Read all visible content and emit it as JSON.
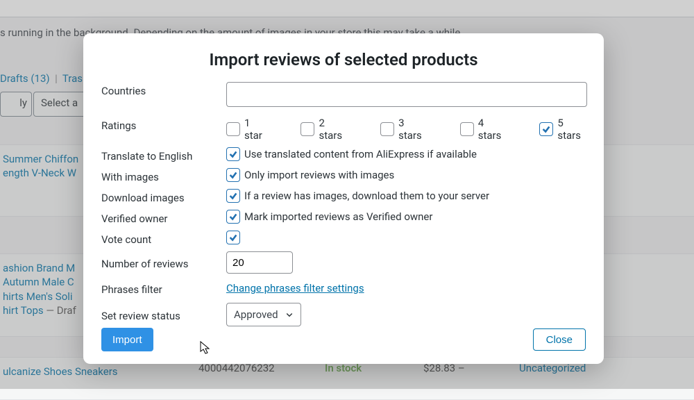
{
  "background": {
    "notice": "s running in the background. Depending on the amount of images in your store this may take a while.",
    "filters": {
      "drafts": "Drafts (13)",
      "trash": "Trash"
    },
    "toolbar": {
      "apply": "ly",
      "select": "Select a"
    },
    "products": [
      {
        "title": "Summer Chiffon\nength V-Neck W"
      },
      {
        "title": "ashion Brand M\nAutumn Male C\nhirts Men's Soli\nhirt Tops",
        "suffix": " — Draf"
      },
      {
        "title": "ulcanize Shoes Sneakers",
        "sku": "4000442076232",
        "stock": "In stock",
        "price": "$28.83 –",
        "category": "Uncategorized"
      }
    ]
  },
  "modal": {
    "title": "Import reviews of selected products",
    "labels": {
      "countries": "Countries",
      "ratings": "Ratings",
      "translate": "Translate to English",
      "with_images": "With images",
      "download_images": "Download images",
      "verified": "Verified owner",
      "vote": "Vote count",
      "num_reviews": "Number of reviews",
      "phrases": "Phrases filter",
      "status": "Set review status"
    },
    "ratings": [
      {
        "label": "1 star",
        "checked": false
      },
      {
        "label": "2 stars",
        "checked": false
      },
      {
        "label": "3 stars",
        "checked": false
      },
      {
        "label": "4 stars",
        "checked": false
      },
      {
        "label": "5 stars",
        "checked": true
      }
    ],
    "translate": {
      "checked": true,
      "text": "Use translated content from AliExpress if available"
    },
    "with_images": {
      "checked": true,
      "text": "Only import reviews with images"
    },
    "download_images": {
      "checked": true,
      "text": "If a review has images, download them to your server"
    },
    "verified": {
      "checked": true,
      "text": "Mark imported reviews as Verified owner"
    },
    "vote": {
      "checked": true
    },
    "num_reviews_value": "20",
    "phrases_link": "Change phrases filter settings",
    "status_value": "Approved",
    "buttons": {
      "import": "Import",
      "close": "Close"
    }
  }
}
